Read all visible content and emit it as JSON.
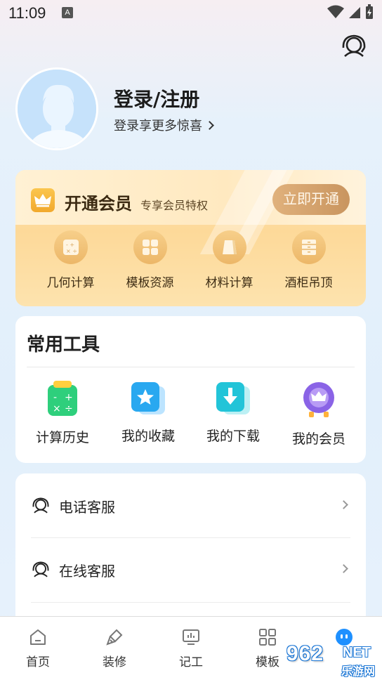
{
  "status_bar": {
    "time": "11:09",
    "badge": "A"
  },
  "header": {
    "support_icon": "headset-icon"
  },
  "profile": {
    "title": "登录/注册",
    "subtitle": "登录享更多惊喜"
  },
  "vip": {
    "title": "开通会员",
    "subtitle": "专享会员特权",
    "button": "立即开通",
    "items": [
      {
        "label": "几何计算",
        "icon": "calculator-icon"
      },
      {
        "label": "模板资源",
        "icon": "grid-icon"
      },
      {
        "label": "材料计算",
        "icon": "board-icon"
      },
      {
        "label": "酒柜吊顶",
        "icon": "cabinet-icon"
      }
    ]
  },
  "tools": {
    "title": "常用工具",
    "items": [
      {
        "label": "计算历史",
        "icon": "calc-history-icon"
      },
      {
        "label": "我的收藏",
        "icon": "star-icon"
      },
      {
        "label": "我的下载",
        "icon": "download-icon"
      },
      {
        "label": "我的会员",
        "icon": "vip-crown-icon"
      }
    ]
  },
  "services": [
    {
      "label": "电话客服",
      "icon": "headset-icon"
    },
    {
      "label": "在线客服",
      "icon": "headset-icon"
    }
  ],
  "tabbar": [
    {
      "label": "首页",
      "icon": "home-icon"
    },
    {
      "label": "装修",
      "icon": "brush-icon"
    },
    {
      "label": "记工",
      "icon": "chart-board-icon"
    },
    {
      "label": "模板",
      "icon": "grid-icon"
    },
    {
      "label": "",
      "icon": "mine-icon",
      "active": true
    }
  ],
  "watermark": {
    "number": "962",
    "net": "NET",
    "text": "乐游网"
  },
  "colors": {
    "accent": "#1e78d6",
    "vip_gold": "#c9955f",
    "tool_green": "#2ecf7c",
    "tool_blue": "#29a8f0",
    "tool_cyan": "#22c4d8",
    "tool_purple": "#8a63e6"
  }
}
